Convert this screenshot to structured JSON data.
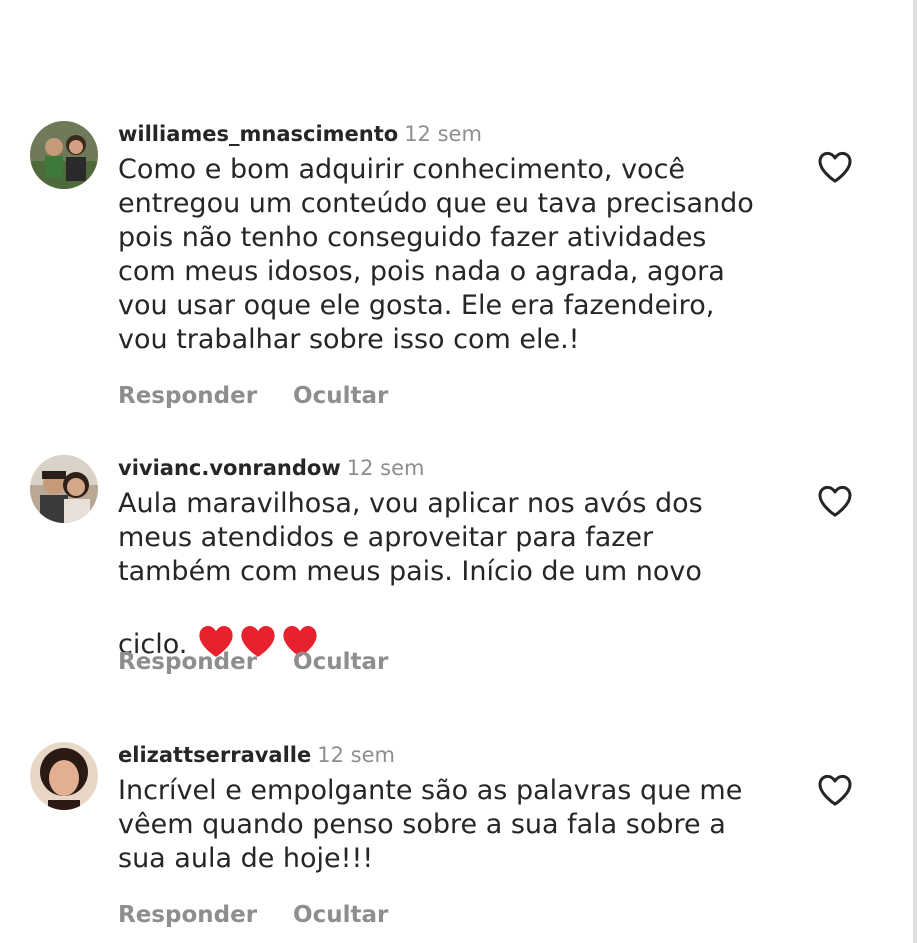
{
  "colors": {
    "username": "#262626",
    "meta": "#8e8e8e",
    "heart_emoji": "#e8212e"
  },
  "comments": [
    {
      "username": "williames_mnascimento",
      "time": "12 sem",
      "text": "Como e bom adquirir conhecimento, você\nentregou um conteúdo que eu tava precisando\npois não tenho conseguido fazer atividades\ncom meus idosos, pois nada o agrada, agora\nvou usar oque ele gosta. Ele era fazendeiro,\nvou trabalhar sobre isso com ele.!",
      "reply_label": "Responder",
      "hide_label": "Ocultar",
      "like_icon": "heart-outline-icon"
    },
    {
      "username": "vivianc.vonrandow",
      "time": "12 sem",
      "text": "Aula maravilhosa, vou aplicar nos avós dos\nmeus atendidos e aproveitar para fazer\ntambém com meus pais. Início de um novo\nciclo.",
      "emoji": "❤️❤️❤️",
      "reply_label": "Responder",
      "hide_label": "Ocultar",
      "like_icon": "heart-outline-icon"
    },
    {
      "username": "elizattserravalle",
      "time": "12 sem",
      "text": "Incrível e empolgante são as palavras que me\nvêem quando penso sobre a sua fala sobre a\nsua aula de hoje!!!",
      "reply_label": "Responder",
      "hide_label": "Ocultar",
      "like_icon": "heart-outline-icon"
    }
  ]
}
